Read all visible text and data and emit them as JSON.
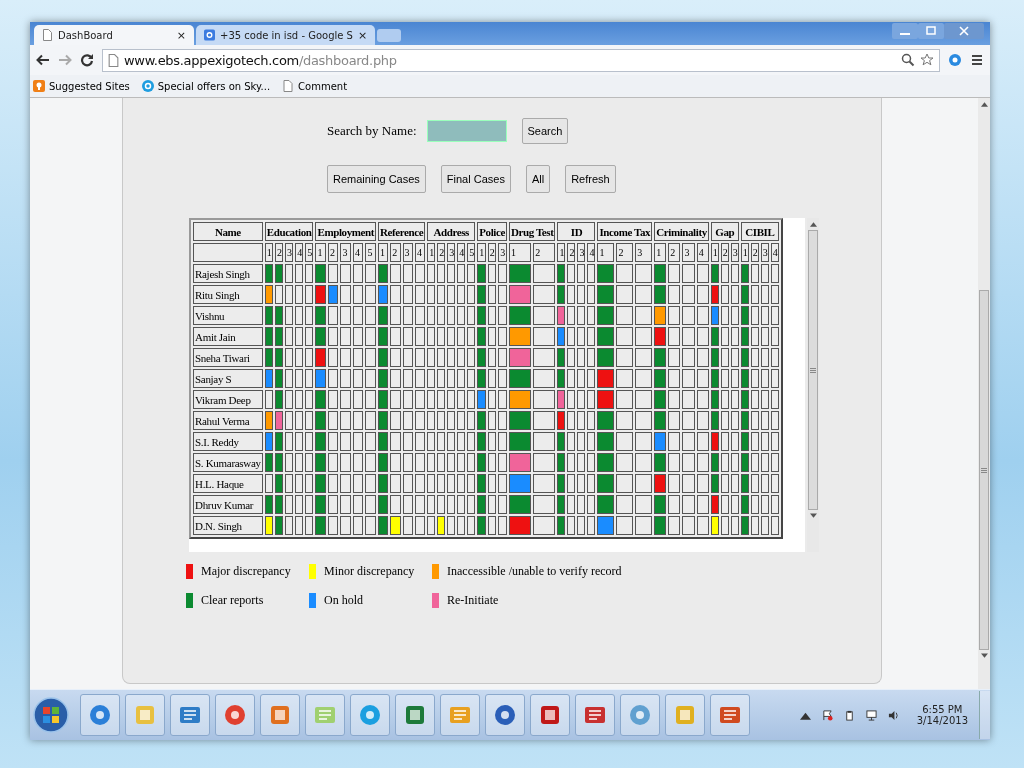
{
  "browser": {
    "tabs": [
      {
        "title": "DashBoard",
        "close": "×",
        "selected": true
      },
      {
        "title": "+35 code in isd - Google S",
        "close": "×",
        "selected": false
      }
    ],
    "url_host": "www.ebs.appexigotech.com",
    "url_path": "/dashboard.php",
    "bookmarks": [
      "Suggested Sites",
      "Special offers on Sky...",
      "Comment"
    ]
  },
  "search": {
    "label": "Search by Name:",
    "button": "Search"
  },
  "actions": [
    "Remaining Cases",
    "Final Cases",
    "All",
    "Refresh"
  ],
  "table": {
    "name_header": "Name",
    "groups": [
      {
        "title": "Education",
        "subcolumns": [
          "1",
          "2",
          "3",
          "4",
          "5"
        ]
      },
      {
        "title": "Employment",
        "subcolumns": [
          "1",
          "2",
          "3",
          "4",
          "5"
        ]
      },
      {
        "title": "Reference",
        "subcolumns": [
          "1",
          "2",
          "3",
          "4"
        ]
      },
      {
        "title": "Address",
        "subcolumns": [
          "1",
          "2",
          "3",
          "4",
          "5"
        ]
      },
      {
        "title": "Police",
        "subcolumns": [
          "1",
          "2",
          "3"
        ]
      },
      {
        "title": "Drug Test",
        "subcolumns": [
          "1",
          "2"
        ]
      },
      {
        "title": "ID",
        "subcolumns": [
          "1",
          "2",
          "3",
          "4"
        ]
      },
      {
        "title": "Income Tax",
        "subcolumns": [
          "1",
          "2",
          "3"
        ]
      },
      {
        "title": "Criminality",
        "subcolumns": [
          "1",
          "2",
          "3",
          "4"
        ]
      },
      {
        "title": "Gap",
        "subcolumns": [
          "1",
          "2",
          "3"
        ]
      },
      {
        "title": "CIBIL",
        "subcolumns": [
          "1",
          "2",
          "3",
          "4"
        ]
      }
    ],
    "rows": [
      {
        "name": "Rajesh Singh",
        "cells": [
          {
            "filled": true,
            "color": "#0b8a30"
          },
          {
            "filled": true,
            "color": "#0b8a30"
          },
          {
            "filled": false
          },
          {
            "filled": false
          },
          {
            "filled": false
          },
          {
            "filled": true,
            "color": "#0b8a30"
          },
          {
            "filled": false
          },
          {
            "filled": false
          },
          {
            "filled": false
          },
          {
            "filled": false
          },
          {
            "filled": true,
            "color": "#0b8a30"
          },
          {
            "filled": false
          },
          {
            "filled": false
          },
          {
            "filled": false
          },
          {
            "filled": false
          },
          {
            "filled": false
          },
          {
            "filled": false
          },
          {
            "filled": false
          },
          {
            "filled": false
          },
          {
            "filled": true,
            "color": "#0b8a30"
          },
          {
            "filled": false
          },
          {
            "filled": false
          },
          {
            "filled": true,
            "color": "#0b8a30"
          },
          {
            "filled": false
          },
          {
            "filled": true,
            "color": "#0b8a30"
          },
          {
            "filled": false
          },
          {
            "filled": false
          },
          {
            "filled": false
          },
          {
            "filled": true,
            "color": "#0b8a30"
          },
          {
            "filled": false
          },
          {
            "filled": false
          },
          {
            "filled": true,
            "color": "#0b8a30"
          },
          {
            "filled": false
          },
          {
            "filled": false
          },
          {
            "filled": false
          },
          {
            "filled": true,
            "color": "#0b8a30"
          },
          {
            "filled": false
          },
          {
            "filled": false
          },
          {
            "filled": true,
            "color": "#0b8a30"
          },
          {
            "filled": false
          },
          {
            "filled": false
          },
          {
            "filled": false
          }
        ]
      },
      {
        "name": "Ritu Singh",
        "cells": [
          {
            "filled": true,
            "color": "#ff9900"
          },
          {
            "filled": false
          },
          {
            "filled": false
          },
          {
            "filled": false
          },
          {
            "filled": false
          },
          {
            "filled": true,
            "color": "#ee1111"
          },
          {
            "filled": true,
            "color": "#1a8cff"
          },
          {
            "filled": false
          },
          {
            "filled": false
          },
          {
            "filled": false
          },
          {
            "filled": true,
            "color": "#1a8cff"
          },
          {
            "filled": false
          },
          {
            "filled": false
          },
          {
            "filled": false
          },
          {
            "filled": false
          },
          {
            "filled": false
          },
          {
            "filled": false
          },
          {
            "filled": false
          },
          {
            "filled": false
          },
          {
            "filled": true,
            "color": "#0b8a30"
          },
          {
            "filled": false
          },
          {
            "filled": false
          },
          {
            "filled": true,
            "color": "#f0649a"
          },
          {
            "filled": false
          },
          {
            "filled": true,
            "color": "#0b8a30"
          },
          {
            "filled": false
          },
          {
            "filled": false
          },
          {
            "filled": false
          },
          {
            "filled": true,
            "color": "#0b8a30"
          },
          {
            "filled": false
          },
          {
            "filled": false
          },
          {
            "filled": true,
            "color": "#0b8a30"
          },
          {
            "filled": false
          },
          {
            "filled": false
          },
          {
            "filled": false
          },
          {
            "filled": true,
            "color": "#ee1111"
          },
          {
            "filled": false
          },
          {
            "filled": false
          },
          {
            "filled": true,
            "color": "#0b8a30"
          },
          {
            "filled": false
          },
          {
            "filled": false
          },
          {
            "filled": false
          }
        ]
      },
      {
        "name": "Vishnu",
        "cells": [
          {
            "filled": true,
            "color": "#0b8a30"
          },
          {
            "filled": true,
            "color": "#0b8a30"
          },
          {
            "filled": false
          },
          {
            "filled": false
          },
          {
            "filled": false
          },
          {
            "filled": true,
            "color": "#0b8a30"
          },
          {
            "filled": false
          },
          {
            "filled": false
          },
          {
            "filled": false
          },
          {
            "filled": false
          },
          {
            "filled": true,
            "color": "#0b8a30"
          },
          {
            "filled": false
          },
          {
            "filled": false
          },
          {
            "filled": false
          },
          {
            "filled": false
          },
          {
            "filled": false
          },
          {
            "filled": false
          },
          {
            "filled": false
          },
          {
            "filled": false
          },
          {
            "filled": true,
            "color": "#0b8a30"
          },
          {
            "filled": false
          },
          {
            "filled": false
          },
          {
            "filled": true,
            "color": "#0b8a30"
          },
          {
            "filled": false
          },
          {
            "filled": true,
            "color": "#f0649a"
          },
          {
            "filled": false
          },
          {
            "filled": false
          },
          {
            "filled": false
          },
          {
            "filled": true,
            "color": "#0b8a30"
          },
          {
            "filled": false
          },
          {
            "filled": false
          },
          {
            "filled": true,
            "color": "#ff9900"
          },
          {
            "filled": false
          },
          {
            "filled": false
          },
          {
            "filled": false
          },
          {
            "filled": true,
            "color": "#1a8cff"
          },
          {
            "filled": false
          },
          {
            "filled": false
          },
          {
            "filled": true,
            "color": "#0b8a30"
          },
          {
            "filled": false
          },
          {
            "filled": false
          },
          {
            "filled": false
          }
        ]
      },
      {
        "name": "Amit Jain",
        "cells": [
          {
            "filled": true,
            "color": "#0b8a30"
          },
          {
            "filled": true,
            "color": "#0b8a30"
          },
          {
            "filled": false
          },
          {
            "filled": false
          },
          {
            "filled": false
          },
          {
            "filled": true,
            "color": "#0b8a30"
          },
          {
            "filled": false
          },
          {
            "filled": false
          },
          {
            "filled": false
          },
          {
            "filled": false
          },
          {
            "filled": true,
            "color": "#0b8a30"
          },
          {
            "filled": false
          },
          {
            "filled": false
          },
          {
            "filled": false
          },
          {
            "filled": false
          },
          {
            "filled": false
          },
          {
            "filled": false
          },
          {
            "filled": false
          },
          {
            "filled": false
          },
          {
            "filled": true,
            "color": "#0b8a30"
          },
          {
            "filled": false
          },
          {
            "filled": false
          },
          {
            "filled": true,
            "color": "#ff9900"
          },
          {
            "filled": false
          },
          {
            "filled": true,
            "color": "#1a8cff"
          },
          {
            "filled": false
          },
          {
            "filled": false
          },
          {
            "filled": false
          },
          {
            "filled": true,
            "color": "#0b8a30"
          },
          {
            "filled": false
          },
          {
            "filled": false
          },
          {
            "filled": true,
            "color": "#ee1111"
          },
          {
            "filled": false
          },
          {
            "filled": false
          },
          {
            "filled": false
          },
          {
            "filled": true,
            "color": "#0b8a30"
          },
          {
            "filled": false
          },
          {
            "filled": false
          },
          {
            "filled": true,
            "color": "#0b8a30"
          },
          {
            "filled": false
          },
          {
            "filled": false
          },
          {
            "filled": false
          }
        ]
      },
      {
        "name": "Sneha Tiwari",
        "cells": [
          {
            "filled": true,
            "color": "#0b8a30"
          },
          {
            "filled": true,
            "color": "#0b8a30"
          },
          {
            "filled": false
          },
          {
            "filled": false
          },
          {
            "filled": false
          },
          {
            "filled": true,
            "color": "#ee1111"
          },
          {
            "filled": false
          },
          {
            "filled": false
          },
          {
            "filled": false
          },
          {
            "filled": false
          },
          {
            "filled": true,
            "color": "#0b8a30"
          },
          {
            "filled": false
          },
          {
            "filled": false
          },
          {
            "filled": false
          },
          {
            "filled": false
          },
          {
            "filled": false
          },
          {
            "filled": false
          },
          {
            "filled": false
          },
          {
            "filled": false
          },
          {
            "filled": true,
            "color": "#0b8a30"
          },
          {
            "filled": false
          },
          {
            "filled": false
          },
          {
            "filled": true,
            "color": "#f0649a"
          },
          {
            "filled": false
          },
          {
            "filled": true,
            "color": "#0b8a30"
          },
          {
            "filled": false
          },
          {
            "filled": false
          },
          {
            "filled": false
          },
          {
            "filled": true,
            "color": "#0b8a30"
          },
          {
            "filled": false
          },
          {
            "filled": false
          },
          {
            "filled": true,
            "color": "#0b8a30"
          },
          {
            "filled": false
          },
          {
            "filled": false
          },
          {
            "filled": false
          },
          {
            "filled": true,
            "color": "#0b8a30"
          },
          {
            "filled": false
          },
          {
            "filled": false
          },
          {
            "filled": true,
            "color": "#0b8a30"
          },
          {
            "filled": false
          },
          {
            "filled": false
          },
          {
            "filled": false
          }
        ]
      },
      {
        "name": "Sanjay S",
        "cells": [
          {
            "filled": true,
            "color": "#1a8cff"
          },
          {
            "filled": true,
            "color": "#0b8a30"
          },
          {
            "filled": false
          },
          {
            "filled": false
          },
          {
            "filled": false
          },
          {
            "filled": true,
            "color": "#1a8cff"
          },
          {
            "filled": false
          },
          {
            "filled": false
          },
          {
            "filled": false
          },
          {
            "filled": false
          },
          {
            "filled": true,
            "color": "#0b8a30"
          },
          {
            "filled": false
          },
          {
            "filled": false
          },
          {
            "filled": false
          },
          {
            "filled": false
          },
          {
            "filled": false
          },
          {
            "filled": false
          },
          {
            "filled": false
          },
          {
            "filled": false
          },
          {
            "filled": true,
            "color": "#0b8a30"
          },
          {
            "filled": false
          },
          {
            "filled": false
          },
          {
            "filled": true,
            "color": "#0b8a30"
          },
          {
            "filled": false
          },
          {
            "filled": true,
            "color": "#0b8a30"
          },
          {
            "filled": false
          },
          {
            "filled": false
          },
          {
            "filled": false
          },
          {
            "filled": true,
            "color": "#ee1111"
          },
          {
            "filled": false
          },
          {
            "filled": false
          },
          {
            "filled": true,
            "color": "#0b8a30"
          },
          {
            "filled": false
          },
          {
            "filled": false
          },
          {
            "filled": false
          },
          {
            "filled": true,
            "color": "#0b8a30"
          },
          {
            "filled": false
          },
          {
            "filled": false
          },
          {
            "filled": true,
            "color": "#0b8a30"
          },
          {
            "filled": false
          },
          {
            "filled": false
          },
          {
            "filled": false
          }
        ]
      },
      {
        "name": "Vikram Deep",
        "cells": [
          {
            "filled": false
          },
          {
            "filled": true,
            "color": "#0b8a30"
          },
          {
            "filled": false
          },
          {
            "filled": false
          },
          {
            "filled": false
          },
          {
            "filled": true,
            "color": "#0b8a30"
          },
          {
            "filled": false
          },
          {
            "filled": false
          },
          {
            "filled": false
          },
          {
            "filled": false
          },
          {
            "filled": true,
            "color": "#0b8a30"
          },
          {
            "filled": false
          },
          {
            "filled": false
          },
          {
            "filled": false
          },
          {
            "filled": false
          },
          {
            "filled": false
          },
          {
            "filled": false
          },
          {
            "filled": false
          },
          {
            "filled": false
          },
          {
            "filled": true,
            "color": "#1a8cff"
          },
          {
            "filled": false
          },
          {
            "filled": false
          },
          {
            "filled": true,
            "color": "#ff9900"
          },
          {
            "filled": false
          },
          {
            "filled": true,
            "color": "#f0649a"
          },
          {
            "filled": false
          },
          {
            "filled": false
          },
          {
            "filled": false
          },
          {
            "filled": true,
            "color": "#ee1111"
          },
          {
            "filled": false
          },
          {
            "filled": false
          },
          {
            "filled": true,
            "color": "#0b8a30"
          },
          {
            "filled": false
          },
          {
            "filled": false
          },
          {
            "filled": false
          },
          {
            "filled": true,
            "color": "#0b8a30"
          },
          {
            "filled": false
          },
          {
            "filled": false
          },
          {
            "filled": true,
            "color": "#0b8a30"
          },
          {
            "filled": false
          },
          {
            "filled": false
          },
          {
            "filled": false
          }
        ]
      },
      {
        "name": "Rahul Verma",
        "cells": [
          {
            "filled": true,
            "color": "#ff9900"
          },
          {
            "filled": true,
            "color": "#f0649a"
          },
          {
            "filled": false
          },
          {
            "filled": false
          },
          {
            "filled": false
          },
          {
            "filled": true,
            "color": "#0b8a30"
          },
          {
            "filled": false
          },
          {
            "filled": false
          },
          {
            "filled": false
          },
          {
            "filled": false
          },
          {
            "filled": true,
            "color": "#0b8a30"
          },
          {
            "filled": false
          },
          {
            "filled": false
          },
          {
            "filled": false
          },
          {
            "filled": false
          },
          {
            "filled": false
          },
          {
            "filled": false
          },
          {
            "filled": false
          },
          {
            "filled": false
          },
          {
            "filled": true,
            "color": "#0b8a30"
          },
          {
            "filled": false
          },
          {
            "filled": false
          },
          {
            "filled": true,
            "color": "#0b8a30"
          },
          {
            "filled": false
          },
          {
            "filled": true,
            "color": "#ee1111"
          },
          {
            "filled": false
          },
          {
            "filled": false
          },
          {
            "filled": false
          },
          {
            "filled": true,
            "color": "#0b8a30"
          },
          {
            "filled": false
          },
          {
            "filled": false
          },
          {
            "filled": true,
            "color": "#0b8a30"
          },
          {
            "filled": false
          },
          {
            "filled": false
          },
          {
            "filled": false
          },
          {
            "filled": true,
            "color": "#0b8a30"
          },
          {
            "filled": false
          },
          {
            "filled": false
          },
          {
            "filled": true,
            "color": "#0b8a30"
          },
          {
            "filled": false
          },
          {
            "filled": false
          },
          {
            "filled": false
          }
        ]
      },
      {
        "name": "S.I. Reddy",
        "cells": [
          {
            "filled": true,
            "color": "#1a8cff"
          },
          {
            "filled": true,
            "color": "#0b8a30"
          },
          {
            "filled": false
          },
          {
            "filled": false
          },
          {
            "filled": false
          },
          {
            "filled": true,
            "color": "#0b8a30"
          },
          {
            "filled": false
          },
          {
            "filled": false
          },
          {
            "filled": false
          },
          {
            "filled": false
          },
          {
            "filled": true,
            "color": "#0b8a30"
          },
          {
            "filled": false
          },
          {
            "filled": false
          },
          {
            "filled": false
          },
          {
            "filled": false
          },
          {
            "filled": false
          },
          {
            "filled": false
          },
          {
            "filled": false
          },
          {
            "filled": false
          },
          {
            "filled": true,
            "color": "#0b8a30"
          },
          {
            "filled": false
          },
          {
            "filled": false
          },
          {
            "filled": true,
            "color": "#0b8a30"
          },
          {
            "filled": false
          },
          {
            "filled": true,
            "color": "#0b8a30"
          },
          {
            "filled": false
          },
          {
            "filled": false
          },
          {
            "filled": false
          },
          {
            "filled": true,
            "color": "#0b8a30"
          },
          {
            "filled": false
          },
          {
            "filled": false
          },
          {
            "filled": true,
            "color": "#1a8cff"
          },
          {
            "filled": false
          },
          {
            "filled": false
          },
          {
            "filled": false
          },
          {
            "filled": true,
            "color": "#ee1111"
          },
          {
            "filled": false
          },
          {
            "filled": false
          },
          {
            "filled": true,
            "color": "#0b8a30"
          },
          {
            "filled": false
          },
          {
            "filled": false
          },
          {
            "filled": false
          }
        ]
      },
      {
        "name": "S. Kumarasway",
        "cells": [
          {
            "filled": true,
            "color": "#0b8a30"
          },
          {
            "filled": true,
            "color": "#0b8a30"
          },
          {
            "filled": false
          },
          {
            "filled": false
          },
          {
            "filled": false
          },
          {
            "filled": true,
            "color": "#0b8a30"
          },
          {
            "filled": false
          },
          {
            "filled": false
          },
          {
            "filled": false
          },
          {
            "filled": false
          },
          {
            "filled": true,
            "color": "#0b8a30"
          },
          {
            "filled": false
          },
          {
            "filled": false
          },
          {
            "filled": false
          },
          {
            "filled": false
          },
          {
            "filled": false
          },
          {
            "filled": false
          },
          {
            "filled": false
          },
          {
            "filled": false
          },
          {
            "filled": true,
            "color": "#0b8a30"
          },
          {
            "filled": false
          },
          {
            "filled": false
          },
          {
            "filled": true,
            "color": "#f0649a"
          },
          {
            "filled": false
          },
          {
            "filled": true,
            "color": "#0b8a30"
          },
          {
            "filled": false
          },
          {
            "filled": false
          },
          {
            "filled": false
          },
          {
            "filled": true,
            "color": "#0b8a30"
          },
          {
            "filled": false
          },
          {
            "filled": false
          },
          {
            "filled": true,
            "color": "#0b8a30"
          },
          {
            "filled": false
          },
          {
            "filled": false
          },
          {
            "filled": false
          },
          {
            "filled": true,
            "color": "#0b8a30"
          },
          {
            "filled": false
          },
          {
            "filled": false
          },
          {
            "filled": true,
            "color": "#0b8a30"
          },
          {
            "filled": false
          },
          {
            "filled": false
          },
          {
            "filled": false
          }
        ]
      },
      {
        "name": "H.L. Haque",
        "cells": [
          {
            "filled": false
          },
          {
            "filled": true,
            "color": "#0b8a30"
          },
          {
            "filled": false
          },
          {
            "filled": false
          },
          {
            "filled": false
          },
          {
            "filled": true,
            "color": "#0b8a30"
          },
          {
            "filled": false
          },
          {
            "filled": false
          },
          {
            "filled": false
          },
          {
            "filled": false
          },
          {
            "filled": true,
            "color": "#0b8a30"
          },
          {
            "filled": false
          },
          {
            "filled": false
          },
          {
            "filled": false
          },
          {
            "filled": false
          },
          {
            "filled": false
          },
          {
            "filled": false
          },
          {
            "filled": false
          },
          {
            "filled": false
          },
          {
            "filled": true,
            "color": "#0b8a30"
          },
          {
            "filled": false
          },
          {
            "filled": false
          },
          {
            "filled": true,
            "color": "#1a8cff"
          },
          {
            "filled": false
          },
          {
            "filled": true,
            "color": "#0b8a30"
          },
          {
            "filled": false
          },
          {
            "filled": false
          },
          {
            "filled": false
          },
          {
            "filled": true,
            "color": "#0b8a30"
          },
          {
            "filled": false
          },
          {
            "filled": false
          },
          {
            "filled": true,
            "color": "#ee1111"
          },
          {
            "filled": false
          },
          {
            "filled": false
          },
          {
            "filled": false
          },
          {
            "filled": true,
            "color": "#0b8a30"
          },
          {
            "filled": false
          },
          {
            "filled": false
          },
          {
            "filled": true,
            "color": "#0b8a30"
          },
          {
            "filled": false
          },
          {
            "filled": false
          },
          {
            "filled": false
          }
        ]
      },
      {
        "name": "Dhruv Kumar",
        "cells": [
          {
            "filled": true,
            "color": "#0b8a30"
          },
          {
            "filled": true,
            "color": "#0b8a30"
          },
          {
            "filled": false
          },
          {
            "filled": false
          },
          {
            "filled": false
          },
          {
            "filled": true,
            "color": "#0b8a30"
          },
          {
            "filled": false
          },
          {
            "filled": false
          },
          {
            "filled": false
          },
          {
            "filled": false
          },
          {
            "filled": true,
            "color": "#0b8a30"
          },
          {
            "filled": false
          },
          {
            "filled": false
          },
          {
            "filled": false
          },
          {
            "filled": false
          },
          {
            "filled": false
          },
          {
            "filled": false
          },
          {
            "filled": false
          },
          {
            "filled": false
          },
          {
            "filled": true,
            "color": "#0b8a30"
          },
          {
            "filled": false
          },
          {
            "filled": false
          },
          {
            "filled": true,
            "color": "#0b8a30"
          },
          {
            "filled": false
          },
          {
            "filled": true,
            "color": "#0b8a30"
          },
          {
            "filled": false
          },
          {
            "filled": false
          },
          {
            "filled": false
          },
          {
            "filled": true,
            "color": "#0b8a30"
          },
          {
            "filled": false
          },
          {
            "filled": false
          },
          {
            "filled": true,
            "color": "#0b8a30"
          },
          {
            "filled": false
          },
          {
            "filled": false
          },
          {
            "filled": false
          },
          {
            "filled": true,
            "color": "#ee1111"
          },
          {
            "filled": false
          },
          {
            "filled": false
          },
          {
            "filled": true,
            "color": "#0b8a30"
          },
          {
            "filled": false
          },
          {
            "filled": false
          },
          {
            "filled": false
          }
        ]
      },
      {
        "name": "D.N. Singh",
        "cells": [
          {
            "filled": true,
            "color": "#ffff00"
          },
          {
            "filled": true,
            "color": "#0b8a30"
          },
          {
            "filled": false
          },
          {
            "filled": false
          },
          {
            "filled": false
          },
          {
            "filled": true,
            "color": "#0b8a30"
          },
          {
            "filled": false
          },
          {
            "filled": false
          },
          {
            "filled": false
          },
          {
            "filled": false
          },
          {
            "filled": true,
            "color": "#0b8a30"
          },
          {
            "filled": true,
            "color": "#ffff00"
          },
          {
            "filled": false
          },
          {
            "filled": false
          },
          {
            "filled": false
          },
          {
            "filled": true,
            "color": "#ffff00"
          },
          {
            "filled": false
          },
          {
            "filled": false
          },
          {
            "filled": false
          },
          {
            "filled": true,
            "color": "#0b8a30"
          },
          {
            "filled": false
          },
          {
            "filled": false
          },
          {
            "filled": true,
            "color": "#ee1111"
          },
          {
            "filled": false
          },
          {
            "filled": true,
            "color": "#0b8a30"
          },
          {
            "filled": false
          },
          {
            "filled": false
          },
          {
            "filled": false
          },
          {
            "filled": true,
            "color": "#1a8cff"
          },
          {
            "filled": false
          },
          {
            "filled": false
          },
          {
            "filled": true,
            "color": "#0b8a30"
          },
          {
            "filled": false
          },
          {
            "filled": false
          },
          {
            "filled": false
          },
          {
            "filled": true,
            "color": "#ffff00"
          },
          {
            "filled": false
          },
          {
            "filled": false
          },
          {
            "filled": true,
            "color": "#0b8a30"
          },
          {
            "filled": false
          },
          {
            "filled": false
          },
          {
            "filled": false
          }
        ]
      }
    ]
  },
  "legend": [
    {
      "label": "Major discrepancy",
      "color": "#ee1111"
    },
    {
      "label": "Minor discrepancy",
      "color": "#ffff00"
    },
    {
      "label": "Inaccessible /unable to verify record",
      "color": "#ff9900"
    },
    {
      "label": "Clear reports",
      "color": "#0b8a30"
    },
    {
      "label": "On hold",
      "color": "#1a8cff"
    },
    {
      "label": "Re-Initiate",
      "color": "#f0649a"
    }
  ],
  "taskbar": {
    "time": "6:55 PM",
    "date": "3/14/2013"
  }
}
